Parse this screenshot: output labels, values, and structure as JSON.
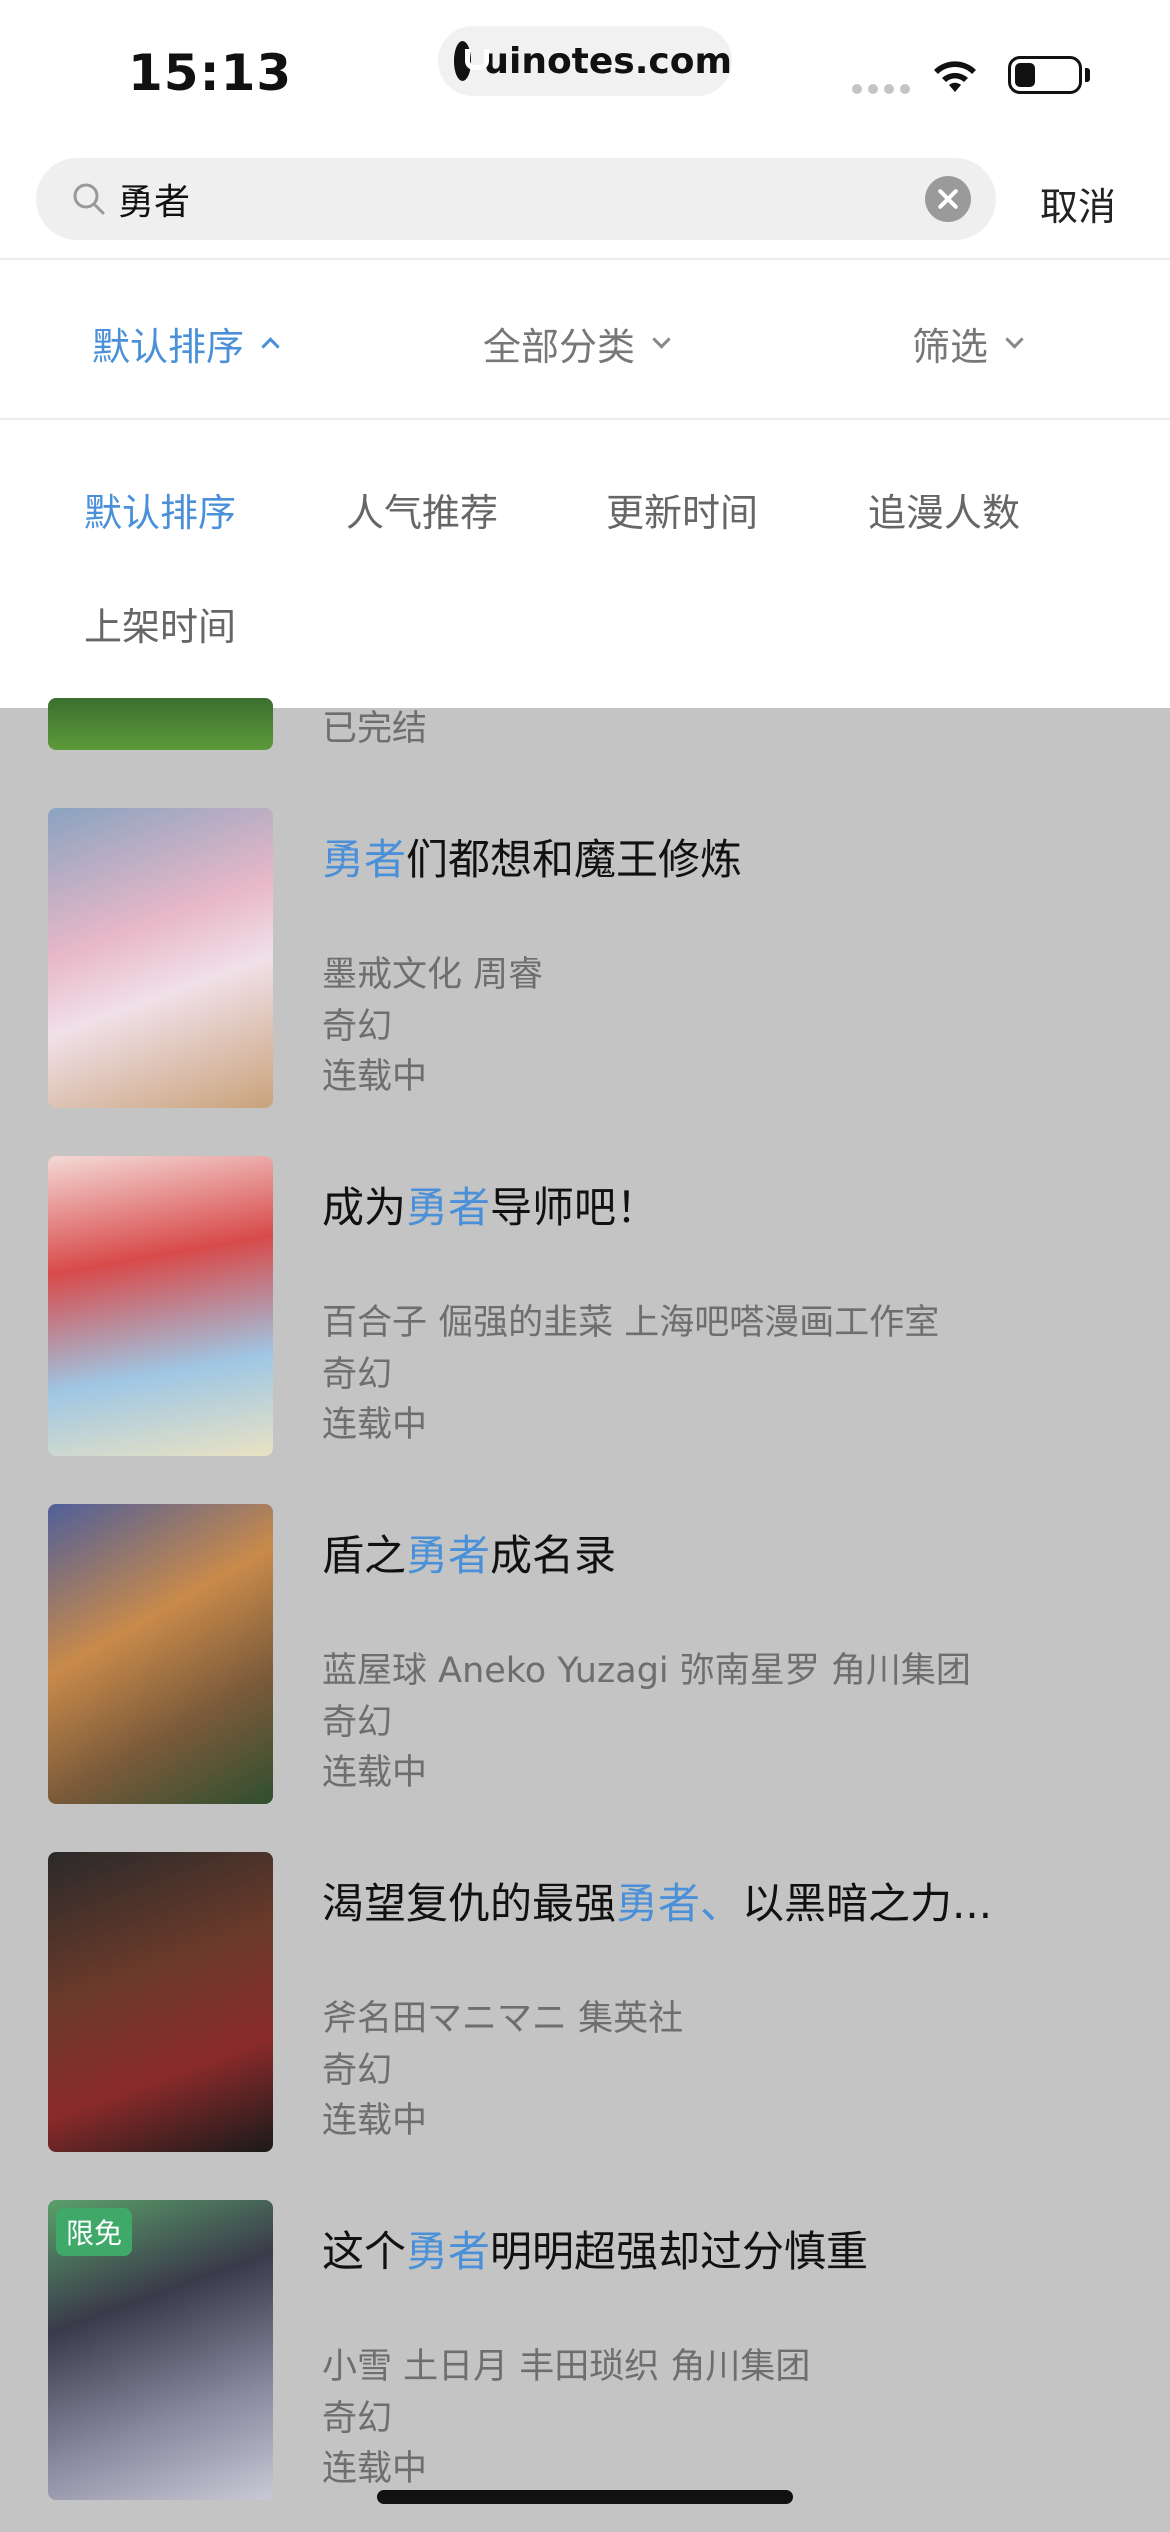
{
  "status_bar": {
    "time": "15:13",
    "url": "uinotes.com"
  },
  "search": {
    "query": "勇者",
    "cancel_label": "取消"
  },
  "filter_tabs": [
    {
      "label": "默认排序",
      "active": true
    },
    {
      "label": "全部分类",
      "active": false
    },
    {
      "label": "筛选",
      "active": false
    }
  ],
  "sort_options": [
    {
      "label": "默认排序",
      "active": true
    },
    {
      "label": "人气推荐",
      "active": false
    },
    {
      "label": "更新时间",
      "active": false
    },
    {
      "label": "追漫人数",
      "active": false
    },
    {
      "label": "上架时间",
      "active": false
    }
  ],
  "colors": {
    "accent": "#4a90d9",
    "overlay": "#c4c4c4",
    "badge": "#3fa96a"
  },
  "partial_item": {
    "status": "已完结"
  },
  "comics": [
    {
      "title_pre": "",
      "title_hl": "勇者",
      "title_post": "们都想和魔王修炼",
      "authors": "墨戒文化 周睿",
      "genre": "奇幻",
      "status": "连载中",
      "badge": ""
    },
    {
      "title_pre": "成为",
      "title_hl": "勇者",
      "title_post": "导师吧！",
      "authors": "百合子 倔强的韭菜 上海吧嗒漫画工作室",
      "genre": "奇幻",
      "status": "连载中",
      "badge": ""
    },
    {
      "title_pre": "盾之",
      "title_hl": "勇者",
      "title_post": "成名录",
      "authors": "蓝屋球 Aneko Yuzagi 弥南星罗 角川集团",
      "genre": "奇幻",
      "status": "连载中",
      "badge": ""
    },
    {
      "title_pre": "渴望复仇的最强",
      "title_hl": "勇者、",
      "title_post": "以黑暗之力...",
      "authors": "斧名田マニマニ 集英社",
      "genre": "奇幻",
      "status": "连载中",
      "badge": ""
    },
    {
      "title_pre": "这个",
      "title_hl": "勇者",
      "title_post": "明明超强却过分慎重",
      "authors": "小雪 土日月 丰田琐织 角川集团",
      "genre": "奇幻",
      "status": "连载中",
      "badge": "限免"
    }
  ]
}
